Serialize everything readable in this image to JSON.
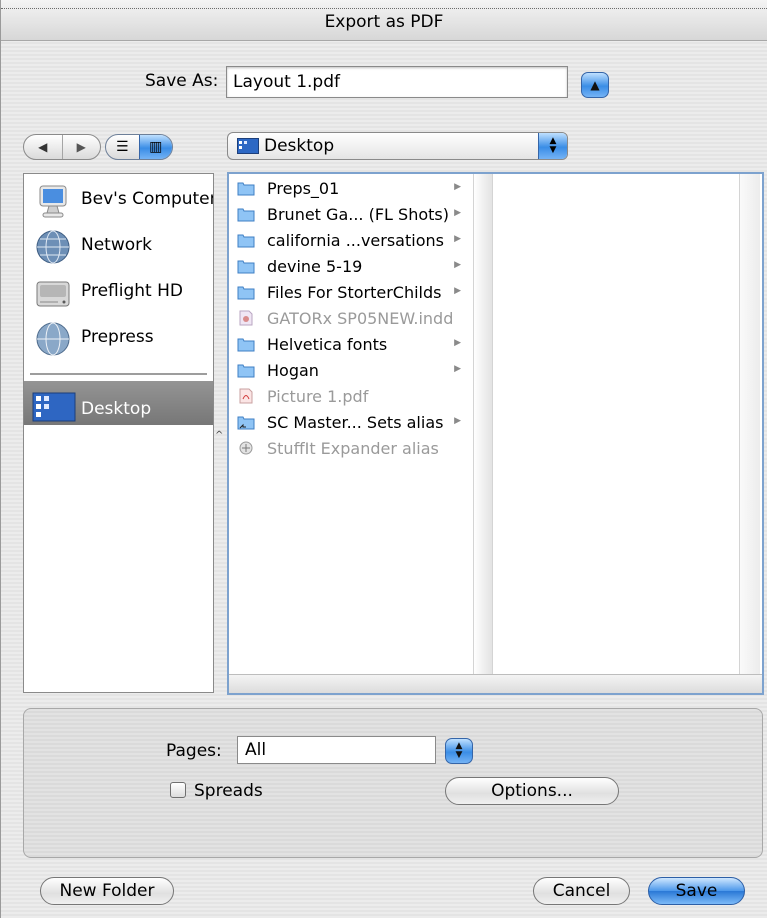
{
  "window": {
    "title": "Export as PDF"
  },
  "save_as": {
    "label": "Save As:",
    "value": "Layout 1.pdf"
  },
  "location": {
    "selected": "Desktop"
  },
  "sidebar": {
    "items": [
      {
        "label": "Bev's Computer",
        "icon": "computer-icon"
      },
      {
        "label": "Network",
        "icon": "network-globe-icon"
      },
      {
        "label": "Preflight HD",
        "icon": "hard-disk-icon"
      },
      {
        "label": "Prepress",
        "icon": "network-volume-icon"
      },
      {
        "label": "Desktop",
        "icon": "desktop-folder-icon",
        "selected": true
      }
    ]
  },
  "browser": {
    "files": [
      {
        "name": "Preps_01",
        "kind": "folder",
        "enabled": true,
        "has_children": true
      },
      {
        "name": "Brunet Ga... (FL Shots)",
        "kind": "folder",
        "enabled": true,
        "has_children": true
      },
      {
        "name": "california ...versations",
        "kind": "folder",
        "enabled": true,
        "has_children": true
      },
      {
        "name": "devine 5-19",
        "kind": "folder",
        "enabled": true,
        "has_children": true
      },
      {
        "name": "Files For StorterChilds",
        "kind": "folder",
        "enabled": true,
        "has_children": true
      },
      {
        "name": "GATORx SP05NEW.indd",
        "kind": "indd",
        "enabled": false,
        "has_children": false
      },
      {
        "name": "Helvetica fonts",
        "kind": "folder",
        "enabled": true,
        "has_children": true
      },
      {
        "name": "Hogan",
        "kind": "folder",
        "enabled": true,
        "has_children": true
      },
      {
        "name": "Picture 1.pdf",
        "kind": "pdf",
        "enabled": false,
        "has_children": false
      },
      {
        "name": "SC Master... Sets alias",
        "kind": "folder-alias",
        "enabled": true,
        "has_children": true
      },
      {
        "name": "StuffIt Expander alias",
        "kind": "app-alias",
        "enabled": false,
        "has_children": false
      }
    ]
  },
  "options": {
    "pages_label": "Pages:",
    "pages_value": "All",
    "spreads_label": "Spreads",
    "spreads_checked": false,
    "options_button": "Options..."
  },
  "buttons": {
    "new_folder": "New Folder",
    "cancel": "Cancel",
    "save": "Save"
  },
  "colors": {
    "accent": "#3a8de6",
    "selection": "#8a8a8a",
    "focus_ring": "#7da2ce"
  }
}
